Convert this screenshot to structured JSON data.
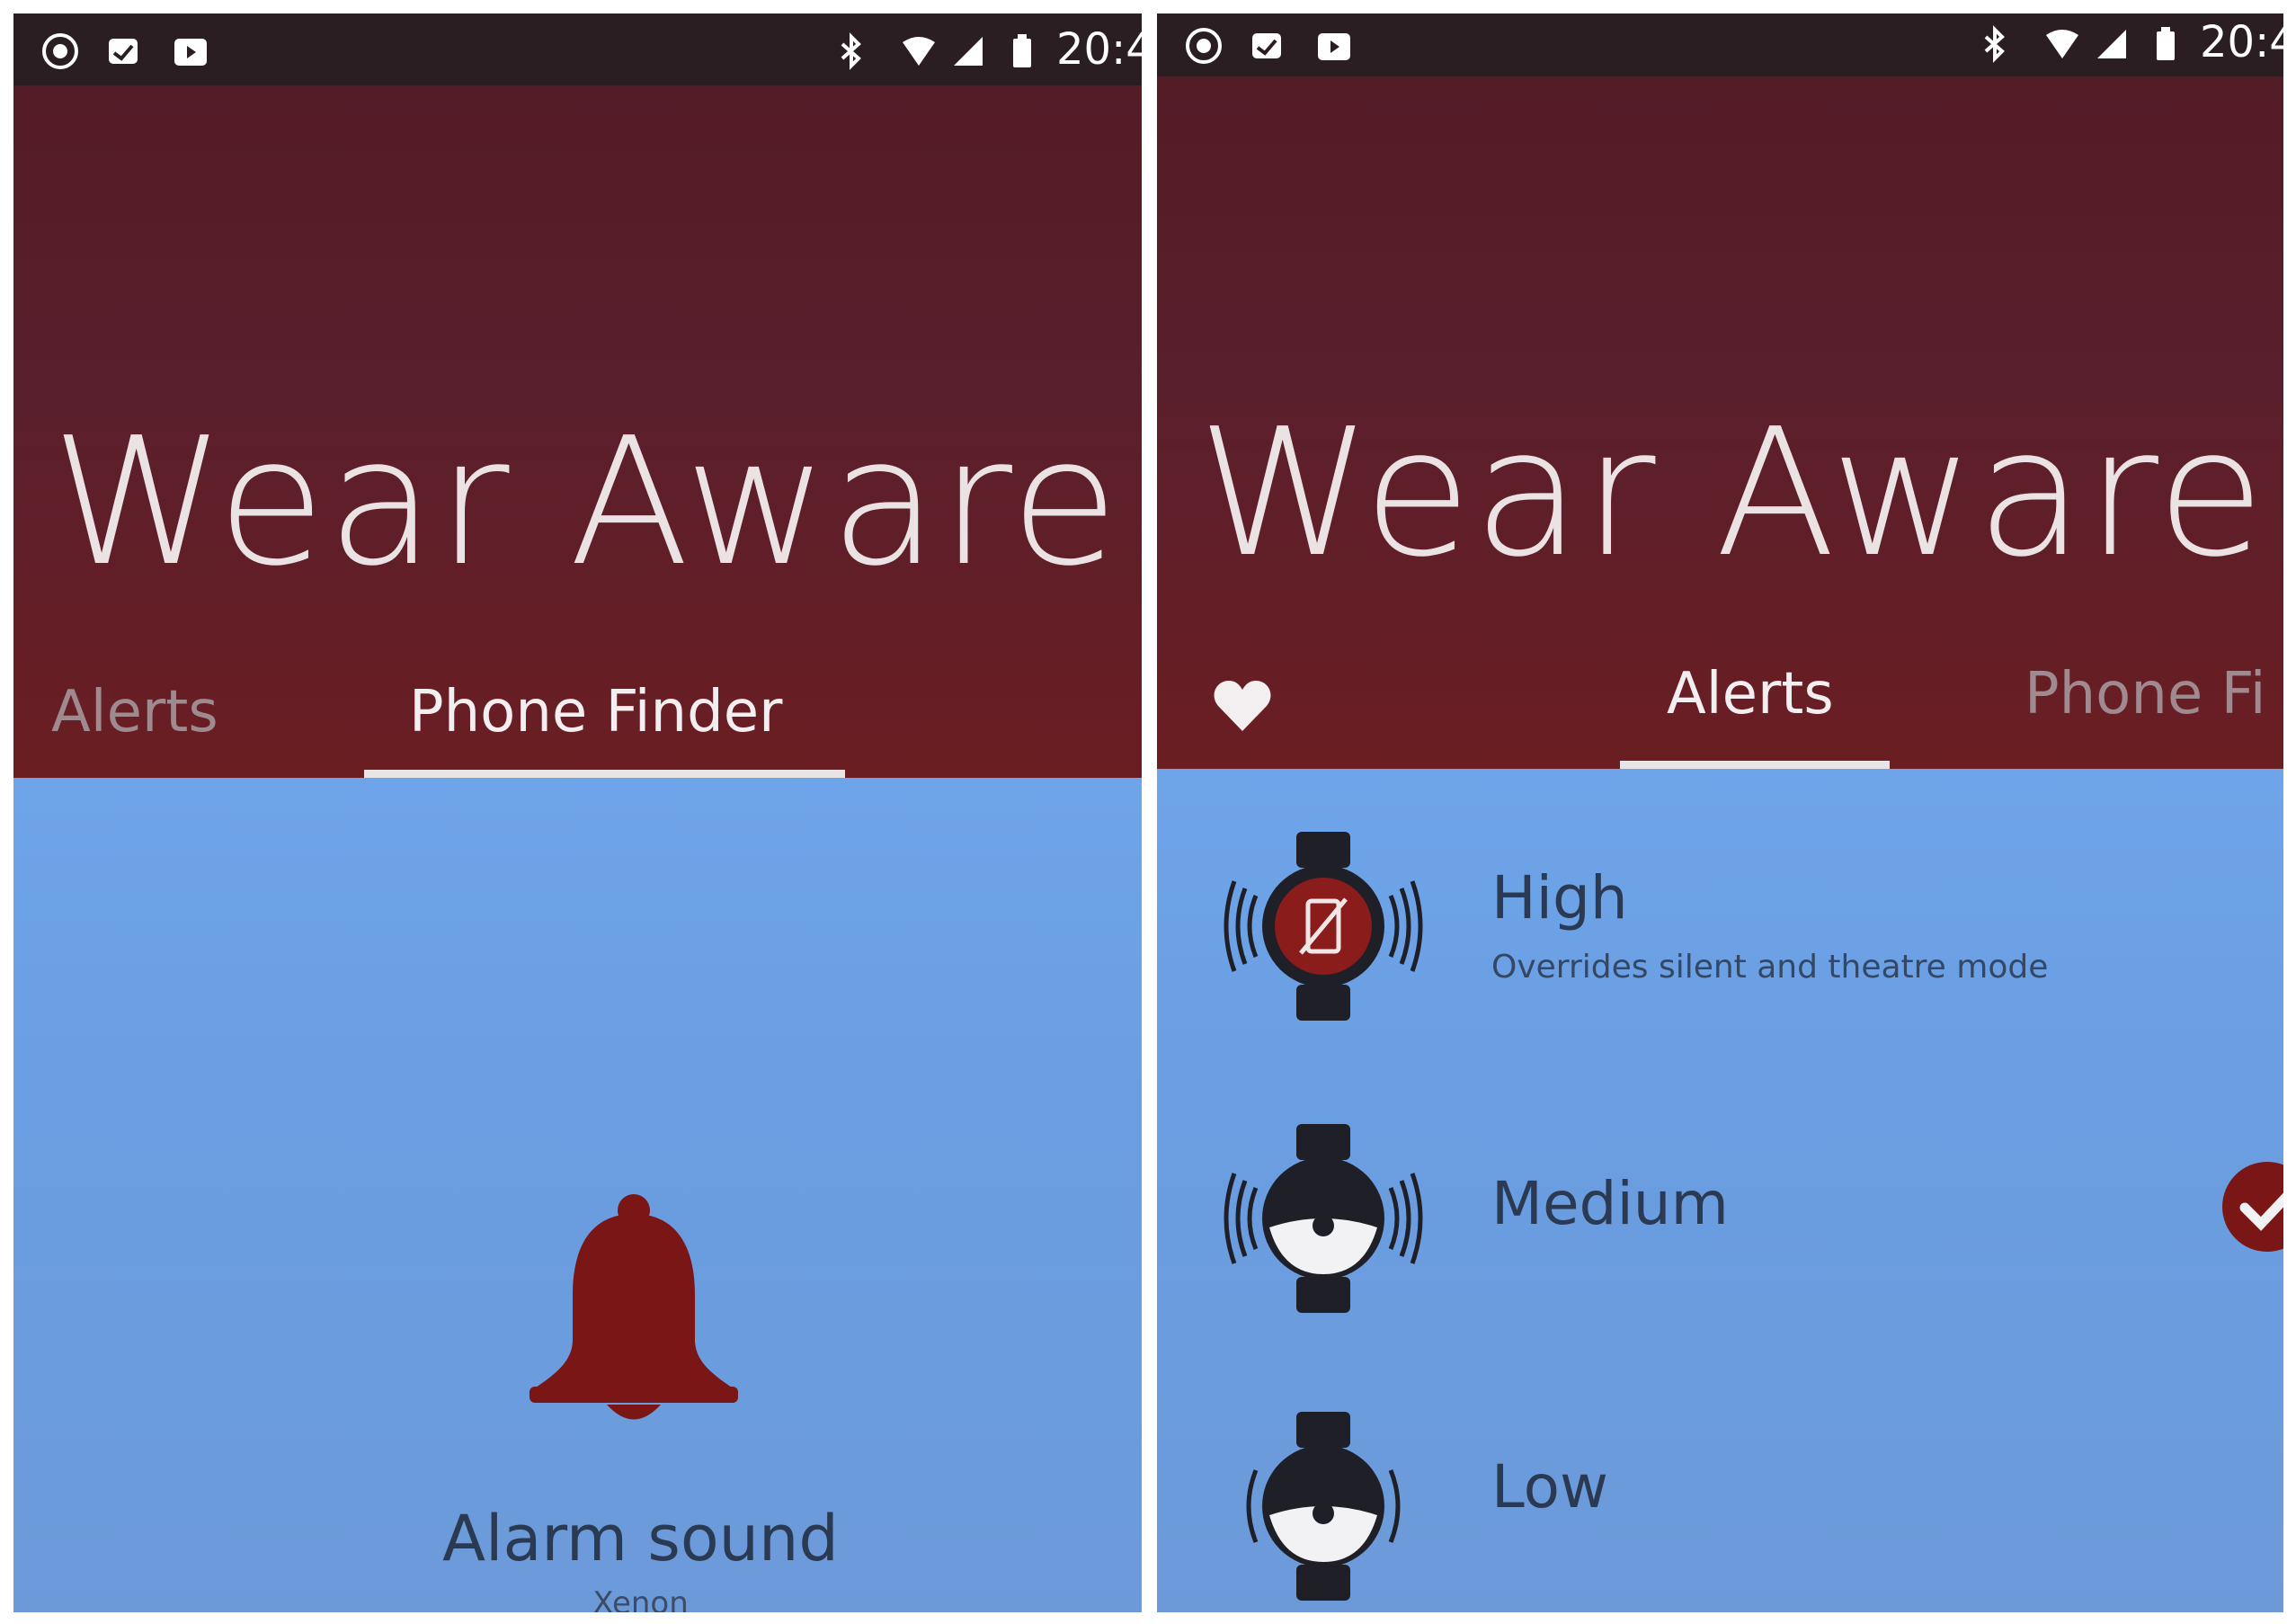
{
  "colors": {
    "header_red": "#5a1f2c",
    "content_blue": "#6ea4e9",
    "accent_red": "#7a1616"
  },
  "status_bar": {
    "time": "20:4",
    "icons": [
      "chromecast-icon",
      "inbox-icon",
      "youtube-icon",
      "bluetooth-icon",
      "wifi-icon",
      "signal-icon",
      "battery-icon"
    ]
  },
  "left": {
    "app_title": "Wear Aware",
    "tabs": [
      {
        "label": "Alerts",
        "active": false
      },
      {
        "label": "Phone Finder",
        "active": true
      }
    ],
    "alarm": {
      "label": "Alarm sound",
      "sound": "Xenon"
    }
  },
  "right": {
    "app_title": "Wear Aware",
    "tabs": [
      {
        "label": "Alerts",
        "active": true
      },
      {
        "label": "Phone Fi",
        "active": false
      }
    ],
    "alert_levels": [
      {
        "title": "High",
        "subtitle": "Overrides silent and theatre mode",
        "selected": false
      },
      {
        "title": "Medium",
        "subtitle": "",
        "selected": true
      },
      {
        "title": "Low",
        "subtitle": "",
        "selected": false
      }
    ]
  }
}
